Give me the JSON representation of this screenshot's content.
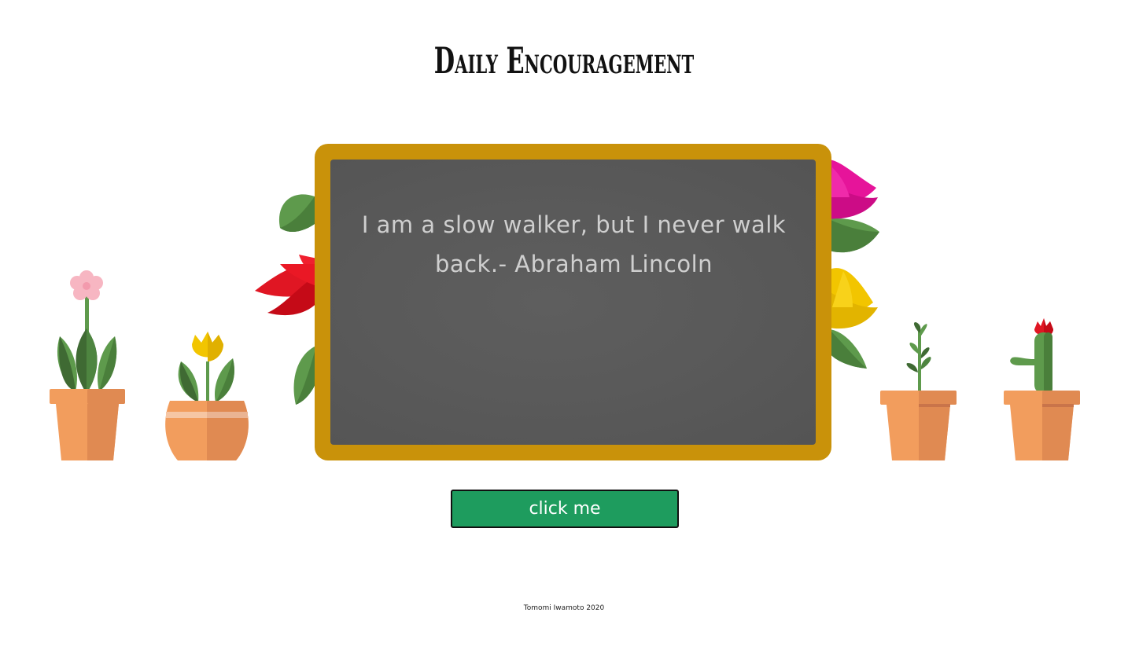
{
  "header": {
    "title": "Daily Encouragement"
  },
  "chalkboard": {
    "quote": "I am a slow walker, but I never walk back.- Abraham Lincoln"
  },
  "actions": {
    "button_label": "click me"
  },
  "footer": {
    "credit": "Tomomi Iwamoto 2020"
  },
  "colors": {
    "frame": "#c9920a",
    "board": "#575757",
    "chalk_text": "#cfcfcf",
    "button": "#1e9c5e",
    "pot": "#f29d5d",
    "pot_shade": "#e08a52",
    "leaf_dark": "#3f6a33",
    "leaf_light": "#5e9a4c"
  },
  "icons": [
    "pink-flower-pot-icon",
    "yellow-tulip-round-pot-icon",
    "sprout-pot-icon",
    "cactus-flower-pot-icon",
    "red-lotus-icon",
    "magenta-lotus-icon",
    "yellow-lotus-icon"
  ]
}
